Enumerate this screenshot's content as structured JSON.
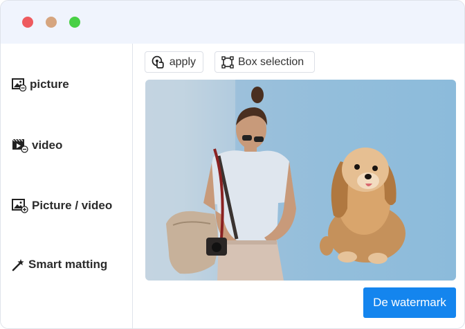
{
  "sidebar": {
    "items": [
      {
        "label": "picture",
        "icon": "image-minus-icon"
      },
      {
        "label": "video",
        "icon": "video-minus-icon"
      },
      {
        "label": "Picture / video",
        "icon": "image-plus-icon"
      },
      {
        "label": "Smart matting",
        "icon": "magic-wand-icon"
      }
    ]
  },
  "toolbar": {
    "apply_label": "apply",
    "apply_icon": "touch-apply-icon",
    "box_label": "Box selection",
    "box_icon": "box-select-icon"
  },
  "canvas": {
    "description_subjects": [
      "woman-with-bag",
      "puppy"
    ],
    "background_color": "#93bedb"
  },
  "action": {
    "primary_label": "De watermark",
    "primary_color": "#1485ee"
  },
  "window_controls": {
    "close_color": "#ee5a5e",
    "minimize_color": "#d6a57f",
    "maximize_color": "#48d045"
  }
}
